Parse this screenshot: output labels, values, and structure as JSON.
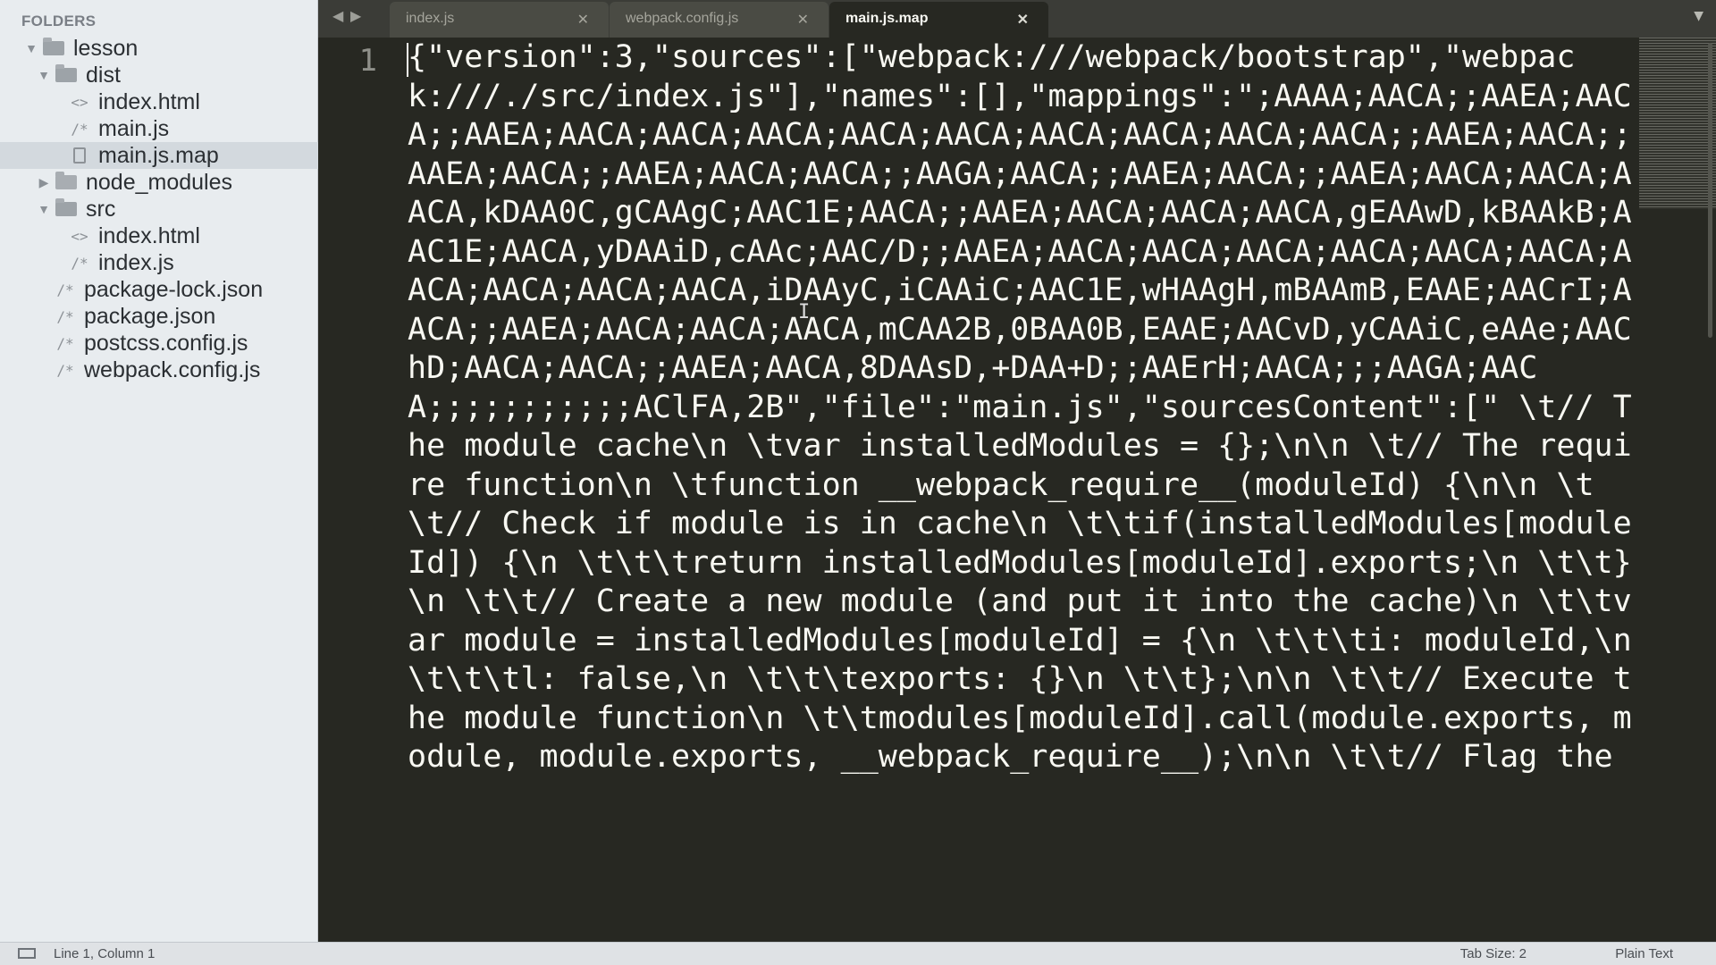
{
  "sidebar": {
    "heading": "FOLDERS",
    "items": [
      {
        "label": "lesson"
      },
      {
        "label": "dist"
      },
      {
        "label": "index.html"
      },
      {
        "label": "main.js"
      },
      {
        "label": "main.js.map"
      },
      {
        "label": "node_modules"
      },
      {
        "label": "src"
      },
      {
        "label": "index.html"
      },
      {
        "label": "index.js"
      },
      {
        "label": "package-lock.json"
      },
      {
        "label": "package.json"
      },
      {
        "label": "postcss.config.js"
      },
      {
        "label": "webpack.config.js"
      }
    ],
    "selected": "main.js.map"
  },
  "tabs": [
    {
      "label": "index.js"
    },
    {
      "label": "webpack.config.js"
    },
    {
      "label": "main.js.map"
    }
  ],
  "active_tab": "main.js.map",
  "editor": {
    "line_number": "1",
    "content": "{\"version\":3,\"sources\":[\"webpack:///webpack/bootstrap\",\"webpack:///./src/index.js\"],\"names\":[],\"mappings\":\";AAAA;AACA;;AAEA;AACA;;AAEA;AACA;AACA;AACA;AACA;AACA;AACA;AACA;AACA;AACA;;AAEA;AACA;;AAEA;AACA;;AAEA;AACA;AACA;;AAGA;AACA;;AAEA;AACA;;AAEA;AACA;AACA;AACA,kDAA0C,gCAAgC;AAC1E;AACA;;AAEA;AACA;AACA;AACA,gEAAwD,kBAAkB;AAC1E;AACA,yDAAiD,cAAc;AAC/D;;AAEA;AACA;AACA;AACA;AACA;AACA;AACA;AACA;AACA;AACA;AACA,iDAAyC,iCAAiC;AAC1E,wHAAgH,mBAAmB,EAAE;AACrI;AACA;;AAEA;AACA;AACA;AACA,mCAA2B,0BAA0B,EAAE;AACvD,yCAAiC,eAAe;AAChD;AACA;AACA;;AAEA;AACA,8DAAsD,+DAA+D;;AAErH;AACA;;;AAGA;AACA;;;;;;;;;;;AClFA,2B\",\"file\":\"main.js\",\"sourcesContent\":[\" \\t// The module cache\\n \\tvar installedModules = {};\\n\\n \\t// The require function\\n \\tfunction __webpack_require__(moduleId) {\\n\\n \\t\\t// Check if module is in cache\\n \\t\\tif(installedModules[moduleId]) {\\n \\t\\t\\treturn installedModules[moduleId].exports;\\n \\t\\t}\\n \\t\\t// Create a new module (and put it into the cache)\\n \\t\\tvar module = installedModules[moduleId] = {\\n \\t\\t\\ti: moduleId,\\n \\t\\t\\tl: false,\\n \\t\\t\\texports: {}\\n \\t\\t};\\n\\n \\t\\t// Execute the module function\\n \\t\\tmodules[moduleId].call(module.exports, module, module.exports, __webpack_require__);\\n\\n \\t\\t// Flag the"
  },
  "status": {
    "position": "Line 1, Column 1",
    "tab_size": "Tab Size: 2",
    "syntax": "Plain Text"
  },
  "icons": {
    "folder": "folder-icon",
    "folder_open": "folder-open-icon",
    "html_file": "code-file-icon",
    "js_file": "comment-file-icon",
    "map_file": "document-icon",
    "panel": "panel-toggle-icon",
    "close": "close-icon",
    "back": "back-arrow-icon",
    "forward": "forward-arrow-icon",
    "tab_menu": "chevron-down-icon"
  },
  "colors": {
    "editor_bg": "#272822",
    "sidebar_bg": "#e8ecef",
    "text": "#f8f8f2",
    "gutter_text": "#8f908a",
    "tab_active_bg": "#272822",
    "tab_inactive_bg": "#4a4b44"
  }
}
